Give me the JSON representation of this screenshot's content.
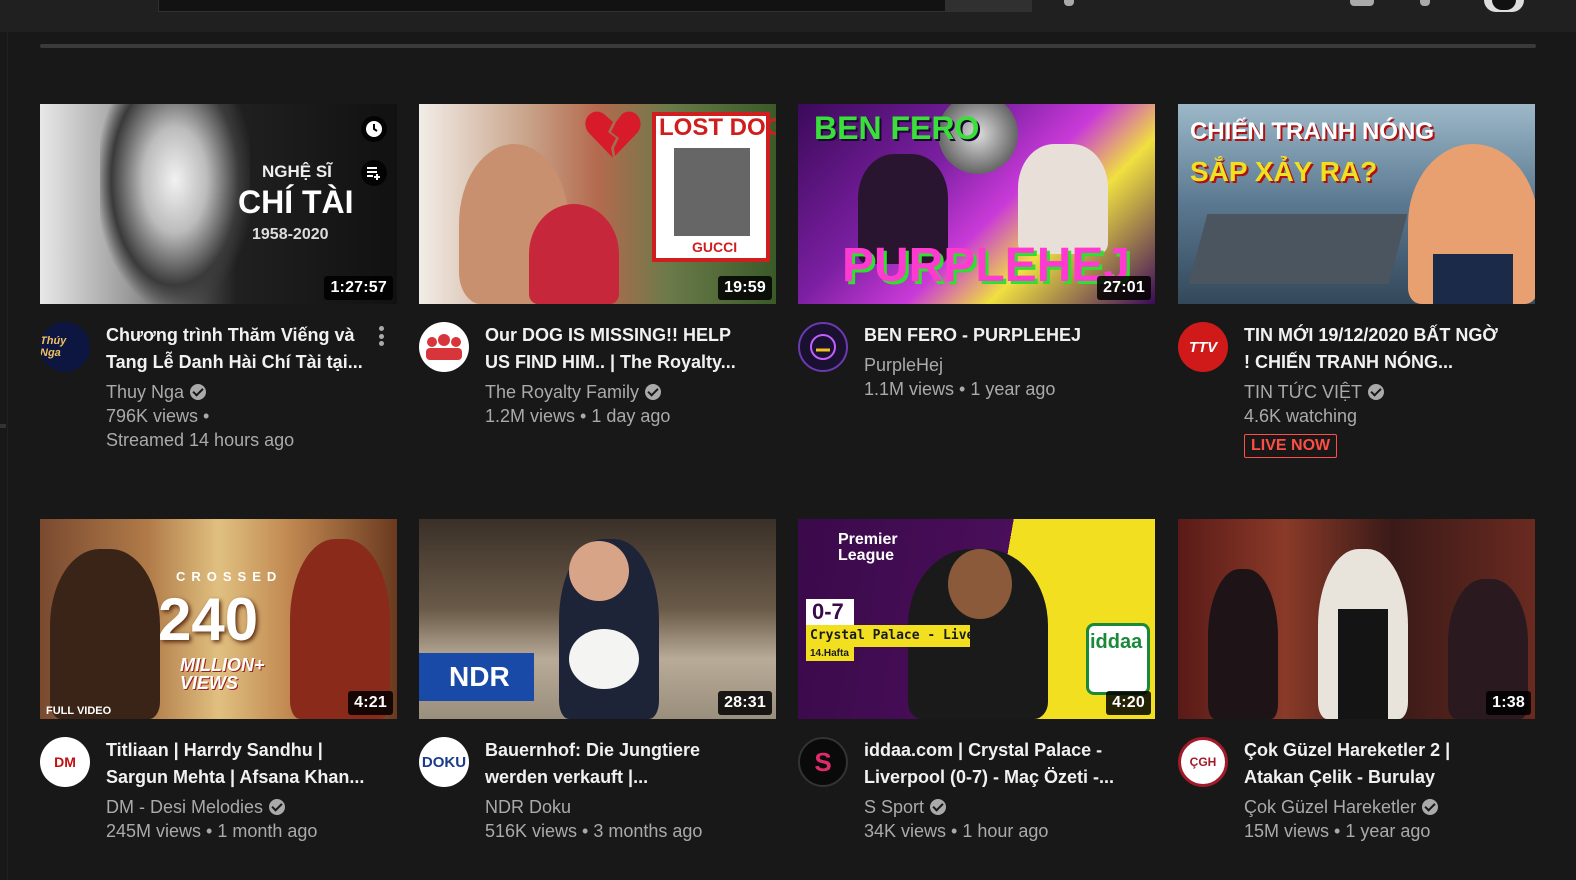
{
  "colors": {
    "background": "#181818",
    "text_primary": "#f1f1f1",
    "text_secondary": "#aaaaaa",
    "live_red": "#ff4e45"
  },
  "videos": [
    {
      "title": "Chương trình Thăm Viếng và Tang Lễ Danh Hài Chí Tài tại...",
      "channel": "Thuy Nga",
      "verified": true,
      "stats_line1": "796K views •",
      "stats_line2": "Streamed 14 hours ago",
      "duration": "1:27:57",
      "avatar_text": "Thúy Nga",
      "thumb_text": {
        "line1": "NGHỆ SĨ",
        "line2": "CHÍ TÀI",
        "line3": "1958-2020"
      }
    },
    {
      "title": "Our DOG IS MISSING!! HELP US FIND HIM.. | The Royalty...",
      "channel": "The Royalty Family",
      "verified": true,
      "stats_line1": "1.2M views • 1 day ago",
      "duration": "19:59",
      "thumb_text": {
        "line1": "LOST DOG",
        "line2": "GUCCI"
      }
    },
    {
      "title": "BEN FERO - PURPLEHEJ",
      "channel": "PurpleHej",
      "verified": false,
      "stats_line1": "1.1M views • 1 year ago",
      "duration": "27:01",
      "thumb_text": {
        "line1": "BEN FERO",
        "line2": "PURPLEHEJ"
      }
    },
    {
      "title": "TIN MỚI 19/12/2020 BẤT NGỜ ! CHIẾN TRANH NÓNG...",
      "channel": "TIN TỨC VIỆT",
      "verified": true,
      "stats_line1": "4.6K watching",
      "live_label": "LIVE NOW",
      "avatar_text": "TTV",
      "thumb_text": {
        "line1": "CHIẾN TRANH NÓNG",
        "line2": "SẮP XẢY RA?"
      }
    },
    {
      "title": "Titliaan | Harrdy Sandhu | Sargun Mehta | Afsana Khan...",
      "channel": "DM - Desi Melodies",
      "verified": true,
      "stats_line1": "245M views • 1 month ago",
      "duration": "4:21",
      "avatar_text": "DM",
      "thumb_text": {
        "line1": "CROSSED",
        "line2": "240",
        "line3": "MILLION+",
        "line4": "VIEWS",
        "line5": "FULL VIDEO"
      }
    },
    {
      "title": "Bauernhof: Die Jungtiere werden verkauft |...",
      "channel": "NDR Doku",
      "verified": false,
      "stats_line1": "516K views • 3 months ago",
      "duration": "28:31",
      "avatar_text": "DOKU",
      "thumb_text": {
        "line1": "NDR"
      }
    },
    {
      "title": "iddaa.com | Crystal Palace - Liverpool (0-7) - Maç Özeti -...",
      "channel": "S Sport",
      "verified": true,
      "stats_line1": "34K views • 1 hour ago",
      "duration": "4:20",
      "avatar_text": "S",
      "thumb_text": {
        "line1": "Premier",
        "line2": "League",
        "line3": "0-7",
        "line4": "Crystal Palace - Liverpool",
        "line5": "14.Hafta",
        "line6": "iddaa"
      }
    },
    {
      "title": "Çok Güzel Hareketler 2 | Atakan Çelik - Burulay",
      "channel": "Çok Güzel Hareketler",
      "verified": true,
      "stats_line1": "15M views • 1 year ago",
      "duration": "1:38",
      "avatar_text": "ÇGH"
    }
  ]
}
